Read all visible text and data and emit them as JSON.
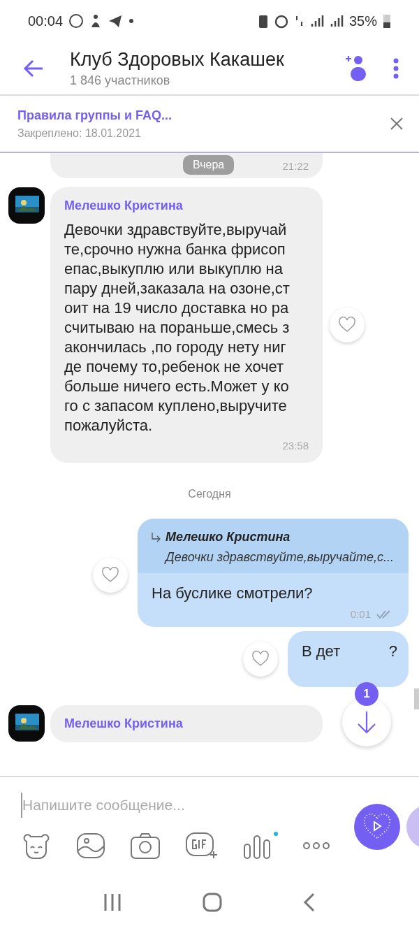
{
  "status_bar": {
    "time": "00:04",
    "battery": "35%"
  },
  "header": {
    "title": "Клуб Здоровых Какашек",
    "subtitle": "1 846 участников"
  },
  "pinned": {
    "title": "Правила группы и FAQ...",
    "date": "Закреплено: 18.01.2021"
  },
  "top_message": {
    "time": "21:22",
    "date_chip": "Вчера"
  },
  "messages": [
    {
      "kind": "incoming",
      "sender": "Мелешко Кристина",
      "text": "Девочки здравствуйте,выручайте,срочно нужна банка фрисопепас,выкуплю или выкуплю на пару дней,заказала на озоне,стоит на 19 число доставка но расчитываю на пораньше,смесь закончилась ,по городу нету нигде почему то,ребенок не хочет больше ничего есть.Может у кого с запасом куплено,выручите пожалуйста.",
      "time": "23:58",
      "liked": false
    },
    {
      "kind": "divider",
      "text": "Сегодня"
    },
    {
      "kind": "outgoing",
      "quote": {
        "sender": "Мелешко Кристина",
        "text": "Девочки здравствуйте,выручайте,с..."
      },
      "text": "На буслике смотрели?",
      "time": "0:01",
      "liked": false
    },
    {
      "kind": "outgoing",
      "text": "В дет",
      "text_tail": "?",
      "liked": false
    },
    {
      "kind": "incoming",
      "sender": "Мелешко Кристина"
    }
  ],
  "scroll_down": {
    "badge": "1"
  },
  "composer": {
    "placeholder": "Напишите сообщение..."
  }
}
